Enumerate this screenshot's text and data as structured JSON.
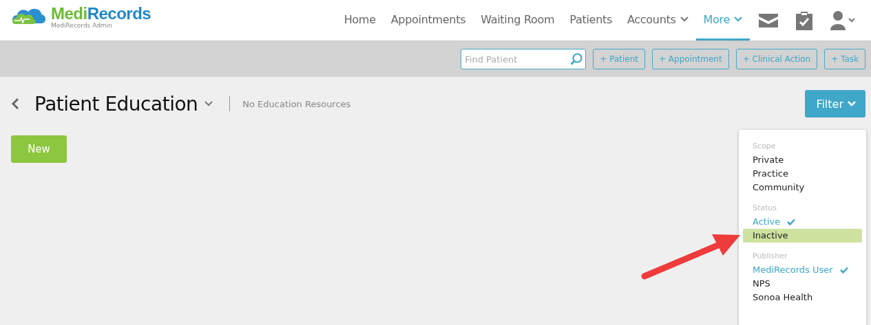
{
  "logo": {
    "name_part1": "Medi",
    "name_part2": "Records",
    "subtitle": "MediRecords Admin"
  },
  "nav": [
    {
      "label": "Home",
      "selected": false,
      "dropdown": false
    },
    {
      "label": "Appointments",
      "selected": false,
      "dropdown": false
    },
    {
      "label": "Waiting Room",
      "selected": false,
      "dropdown": false
    },
    {
      "label": "Patients",
      "selected": false,
      "dropdown": false
    },
    {
      "label": "Accounts",
      "selected": false,
      "dropdown": true
    },
    {
      "label": "More",
      "selected": true,
      "dropdown": true
    }
  ],
  "toolbar": {
    "search": {
      "placeholder": "Find Patient"
    },
    "buttons": [
      "+ Patient",
      "+ Appointment",
      "+ Clinical Action",
      "+ Task"
    ]
  },
  "page": {
    "title": "Patient Education",
    "subtitle": "No Education Resources",
    "new_button": "New",
    "filter_button": "Filter"
  },
  "filter_menu": [
    {
      "heading": "Scope",
      "items": [
        {
          "label": "Private",
          "checked": false,
          "highlighted": false
        },
        {
          "label": "Practice",
          "checked": false,
          "highlighted": false
        },
        {
          "label": "Community",
          "checked": false,
          "highlighted": false
        }
      ]
    },
    {
      "heading": "Status",
      "items": [
        {
          "label": "Active",
          "checked": true,
          "highlighted": false
        },
        {
          "label": "Inactive",
          "checked": false,
          "highlighted": true
        }
      ]
    },
    {
      "heading": "Publisher",
      "items": [
        {
          "label": "MediRecords User",
          "checked": true,
          "highlighted": false
        },
        {
          "label": "NPS",
          "checked": false,
          "highlighted": false
        },
        {
          "label": "Sonoa Health",
          "checked": false,
          "highlighted": false
        }
      ]
    }
  ]
}
